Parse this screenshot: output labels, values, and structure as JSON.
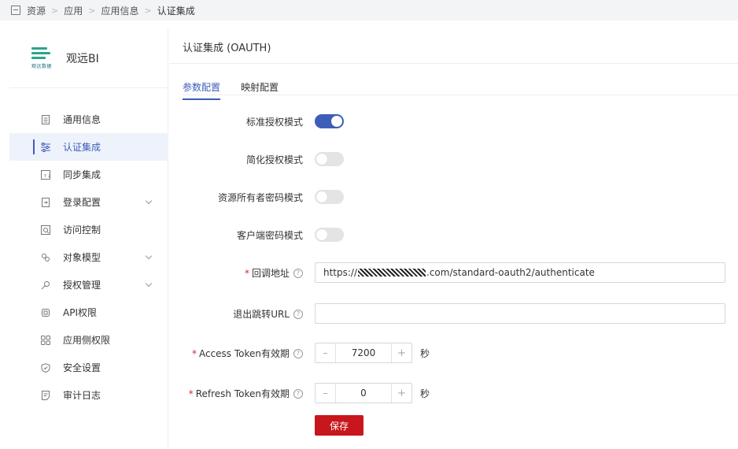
{
  "breadcrumb": [
    "资源",
    "应用",
    "应用信息",
    "认证集成"
  ],
  "brand": {
    "name": "观远BI",
    "logo_text": "观远数据",
    "logo_color": "#2aa58d"
  },
  "sidebar": {
    "items": [
      {
        "label": "通用信息",
        "icon": "document-icon",
        "expandable": false,
        "active": false
      },
      {
        "label": "认证集成",
        "icon": "sliders-icon",
        "expandable": false,
        "active": true
      },
      {
        "label": "同步集成",
        "icon": "sync-icon",
        "expandable": false,
        "active": false
      },
      {
        "label": "登录配置",
        "icon": "login-icon",
        "expandable": true,
        "active": false
      },
      {
        "label": "访问控制",
        "icon": "access-icon",
        "expandable": false,
        "active": false
      },
      {
        "label": "对象模型",
        "icon": "model-icon",
        "expandable": true,
        "active": false
      },
      {
        "label": "授权管理",
        "icon": "key-icon",
        "expandable": true,
        "active": false
      },
      {
        "label": "API权限",
        "icon": "api-icon",
        "expandable": false,
        "active": false
      },
      {
        "label": "应用侧权限",
        "icon": "grid-icon",
        "expandable": false,
        "active": false
      },
      {
        "label": "安全设置",
        "icon": "shield-icon",
        "expandable": false,
        "active": false
      },
      {
        "label": "审计日志",
        "icon": "log-icon",
        "expandable": false,
        "active": false
      }
    ]
  },
  "main": {
    "title": "认证集成 (OAUTH)",
    "tabs": [
      {
        "label": "参数配置",
        "active": true
      },
      {
        "label": "映射配置",
        "active": false
      }
    ],
    "toggles": [
      {
        "label": "标准授权模式",
        "on": true
      },
      {
        "label": "简化授权模式",
        "on": false
      },
      {
        "label": "资源所有者密码模式",
        "on": false
      },
      {
        "label": "客户端密码模式",
        "on": false
      }
    ],
    "callback": {
      "label": "回调地址",
      "required": true,
      "value_prefix": "https://",
      "value_suffix": ".com/standard-oauth2/authenticate"
    },
    "logout_url": {
      "label": "退出跳转URL",
      "value": ""
    },
    "access_token": {
      "label": "Access Token有效期",
      "required": true,
      "value": "7200",
      "unit": "秒"
    },
    "refresh_token": {
      "label": "Refresh Token有效期",
      "required": true,
      "value": "0",
      "unit": "秒"
    },
    "save_label": "保存",
    "accent": "#3d5eb8",
    "danger": "#c8161d"
  }
}
